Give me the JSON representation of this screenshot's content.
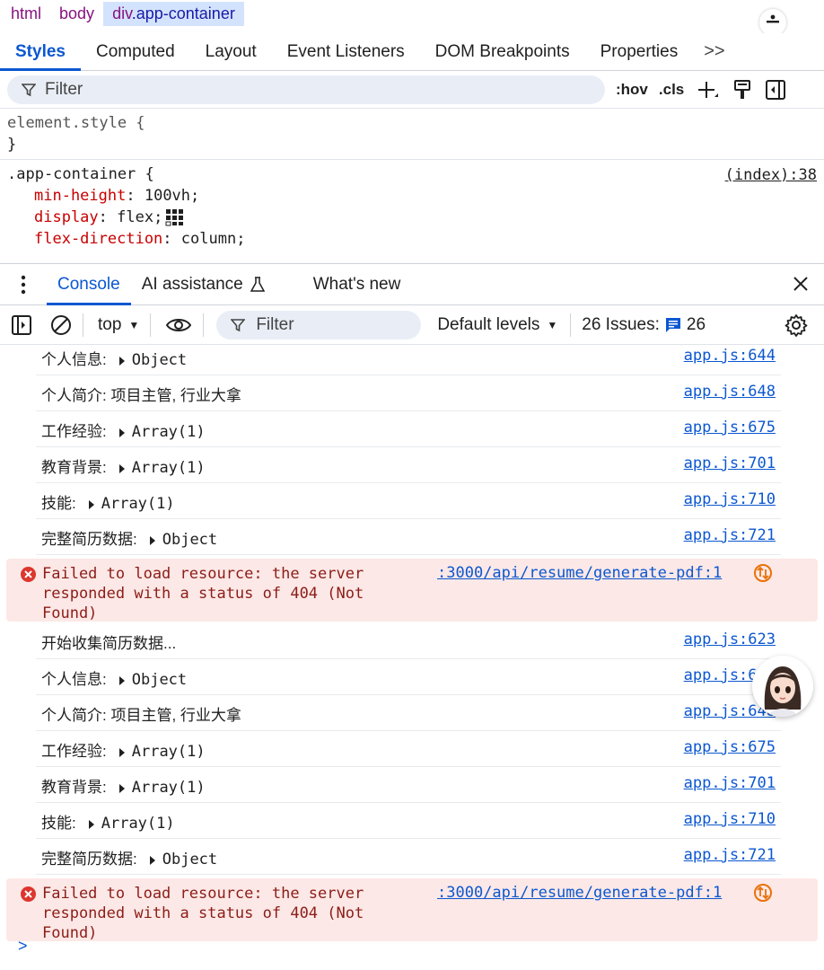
{
  "breadcrumb": [
    {
      "label": "html"
    },
    {
      "label": "body"
    },
    {
      "tag": "div",
      "cls": ".app-container"
    }
  ],
  "styles_tabs": [
    "Styles",
    "Computed",
    "Layout",
    "Event Listeners",
    "DOM Breakpoints",
    "Properties"
  ],
  "styles_more": ">>",
  "filter": {
    "placeholder": "Filter",
    "hov": ":hov",
    "cls": ".cls"
  },
  "rules": {
    "element_style_open": "element.style {",
    "close": "}",
    "app_selector": ".app-container {",
    "app_source": "(index):38",
    "props": [
      {
        "name": "min-height",
        "value": "100vh;"
      },
      {
        "name": "display",
        "value": "flex;"
      },
      {
        "name": "flex-direction",
        "value": "column;"
      }
    ]
  },
  "drawer": {
    "tabs": [
      "Console",
      "AI assistance",
      "What's new"
    ]
  },
  "console_toolbar": {
    "context": "top",
    "filter_placeholder": "Filter",
    "levels": "Default levels",
    "issues_label": "26 Issues:",
    "issues_count": "26"
  },
  "messages": [
    {
      "kind": "log",
      "label": "个人信息:",
      "value": "Object",
      "expandable": true,
      "source": "app.js:644"
    },
    {
      "kind": "log",
      "label": "个人简介: 项目主管, 行业大拿",
      "value": "",
      "expandable": false,
      "source": "app.js:648"
    },
    {
      "kind": "log",
      "label": "工作经验:",
      "value": "Array(1)",
      "expandable": true,
      "source": "app.js:675"
    },
    {
      "kind": "log",
      "label": "教育背景:",
      "value": "Array(1)",
      "expandable": true,
      "source": "app.js:701"
    },
    {
      "kind": "log",
      "label": "技能:",
      "value": "Array(1)",
      "expandable": true,
      "source": "app.js:710"
    },
    {
      "kind": "log",
      "label": "完整简历数据:",
      "value": "Object",
      "expandable": true,
      "source": "app.js:721"
    },
    {
      "kind": "error",
      "text": "Failed to load resource: the server responded with a status of 404 (Not Found)",
      "source": ":3000/api/resume/generate-pdf:1"
    },
    {
      "kind": "log",
      "label": "开始收集简历数据...",
      "value": "",
      "expandable": false,
      "source": "app.js:623"
    },
    {
      "kind": "log",
      "label": "个人信息:",
      "value": "Object",
      "expandable": true,
      "source": "app.js:644"
    },
    {
      "kind": "log",
      "label": "个人简介: 项目主管, 行业大拿",
      "value": "",
      "expandable": false,
      "source": "app.js:648"
    },
    {
      "kind": "log",
      "label": "工作经验:",
      "value": "Array(1)",
      "expandable": true,
      "source": "app.js:675"
    },
    {
      "kind": "log",
      "label": "教育背景:",
      "value": "Array(1)",
      "expandable": true,
      "source": "app.js:701"
    },
    {
      "kind": "log",
      "label": "技能:",
      "value": "Array(1)",
      "expandable": true,
      "source": "app.js:710"
    },
    {
      "kind": "log",
      "label": "完整简历数据:",
      "value": "Object",
      "expandable": true,
      "source": "app.js:721"
    },
    {
      "kind": "error",
      "text": "Failed to load resource: the server responded with a status of 404 (Not Found)",
      "source": ":3000/api/resume/generate-pdf:1"
    }
  ],
  "prompt": ">",
  "colors": {
    "accent": "#0b57d0",
    "error_bg": "#fce8e6",
    "error_text": "#8c1d18",
    "css_prop": "#c80000",
    "tag": "#881280"
  }
}
